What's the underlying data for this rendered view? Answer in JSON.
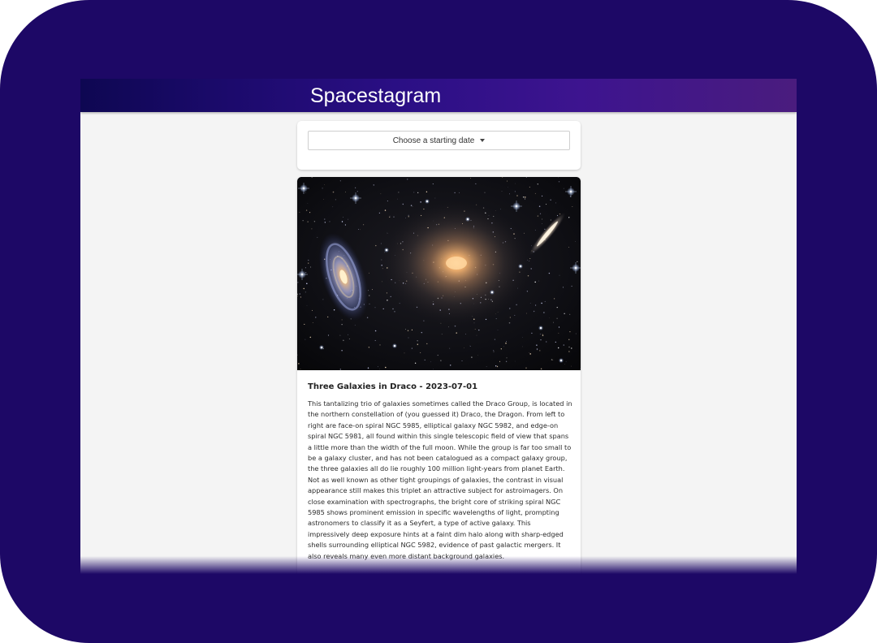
{
  "header": {
    "title": "Spacestagram"
  },
  "date_picker": {
    "label": "Choose a starting date"
  },
  "post": {
    "title": "Three Galaxies in Draco - 2023-07-01",
    "explanation": "This tantalizing trio of galaxies sometimes called the Draco Group, is located in the northern constellation of (you guessed it) Draco, the Dragon. From left to right are face-on spiral NGC 5985, elliptical galaxy NGC 5982, and edge-on spiral NGC 5981, all found within this single telescopic field of view that spans a little more than the width of the full moon. While the group is far too small to be a galaxy cluster, and has not been catalogued as a compact galaxy group, the three galaxies all do lie roughly 100 million light-years from planet Earth. Not as well known as other tight groupings of galaxies, the contrast in visual appearance still makes this triplet an attractive subject for astroimagers. On close examination with spectrographs, the bright core of striking spiral NGC 5985 shows prominent emission in specific wavelengths of light, prompting astronomers to classify it as a Seyfert, a type of active galaxy. This impressively deep exposure hints at a faint dim halo along with sharp-edged shells surrounding elliptical NGC 5982, evidence of past galactic mergers. It also reveals many even more distant background galaxies."
  },
  "colors": {
    "frame_background": "#1d0866",
    "page_background": "#f4f4f4",
    "header_gradient_start": "#0e0752",
    "header_gradient_end": "#4a1c7e"
  },
  "icons": {
    "date_picker_caret": "caret-down-icon"
  }
}
